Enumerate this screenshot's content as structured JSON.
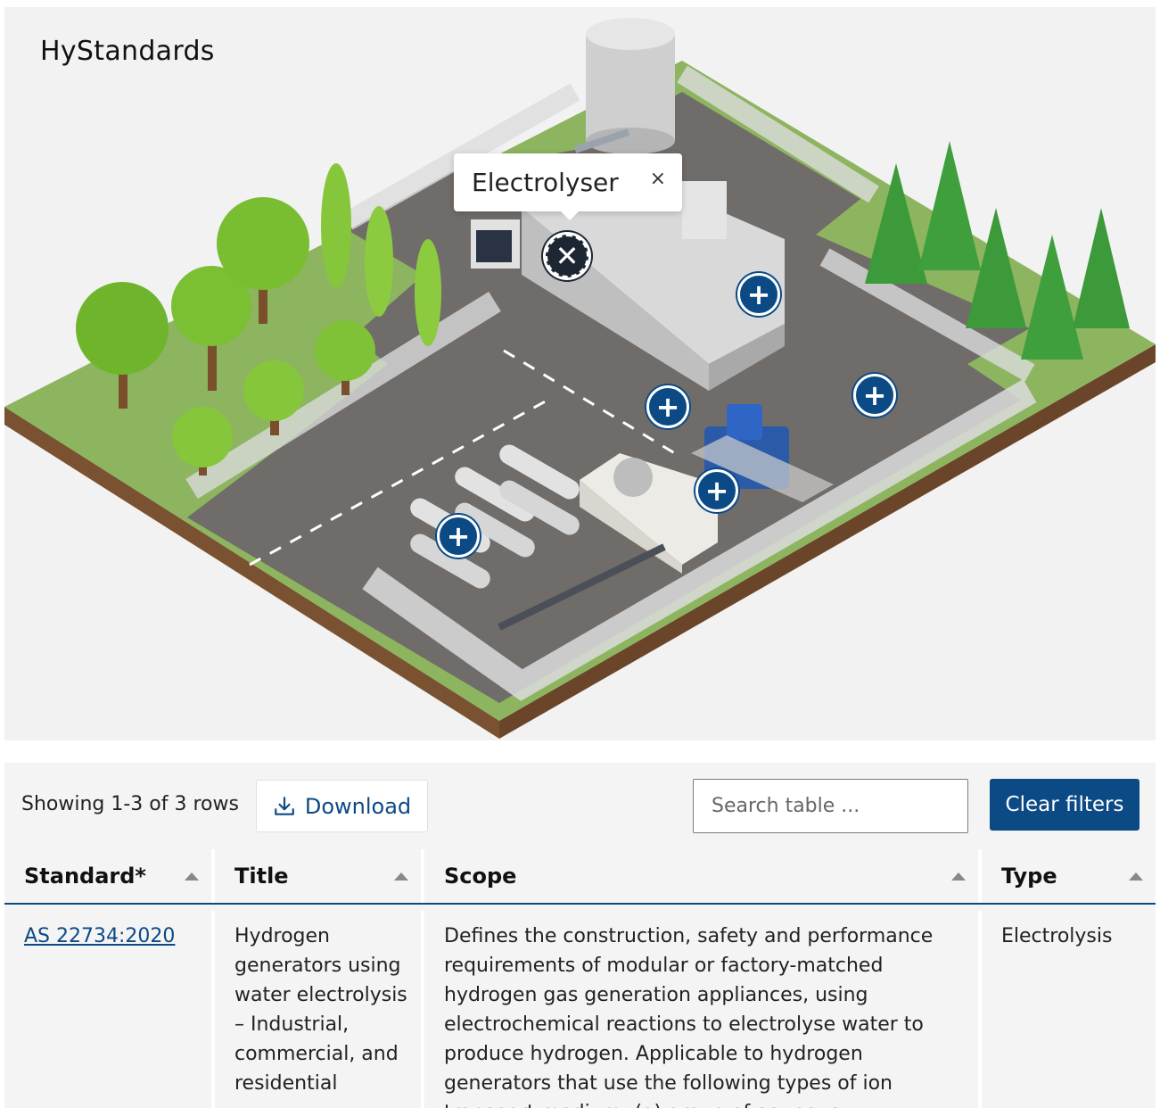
{
  "brand": "HyStandards",
  "tooltip": {
    "title": "Electrolyser",
    "close": "×"
  },
  "hotspots": {
    "plus": "+",
    "close": "✕"
  },
  "toolbar": {
    "rows_text": "Showing 1-3 of 3 rows",
    "download_label": "Download",
    "search_placeholder": "Search table ...",
    "clear_label": "Clear filters"
  },
  "table": {
    "headers": [
      "Standard*",
      "Title",
      "Scope",
      "Type"
    ],
    "rows": [
      {
        "standard": "AS 22734:2020",
        "title": "Hydrogen generators using water electrolysis – Industrial, commercial, and residential",
        "scope": "Defines the construction, safety and performance requirements of modular or factory-matched hydrogen gas generation appliances, using electrochemical reactions to electrolyse water to produce hydrogen. Applicable to hydrogen generators that use the following types of ion transport medium: (a) group of aqueous",
        "type": "Electrolysis"
      }
    ]
  },
  "colors": {
    "accent": "#0c4a85",
    "ground": "#8bb25e",
    "asphalt": "#6d6a68"
  }
}
